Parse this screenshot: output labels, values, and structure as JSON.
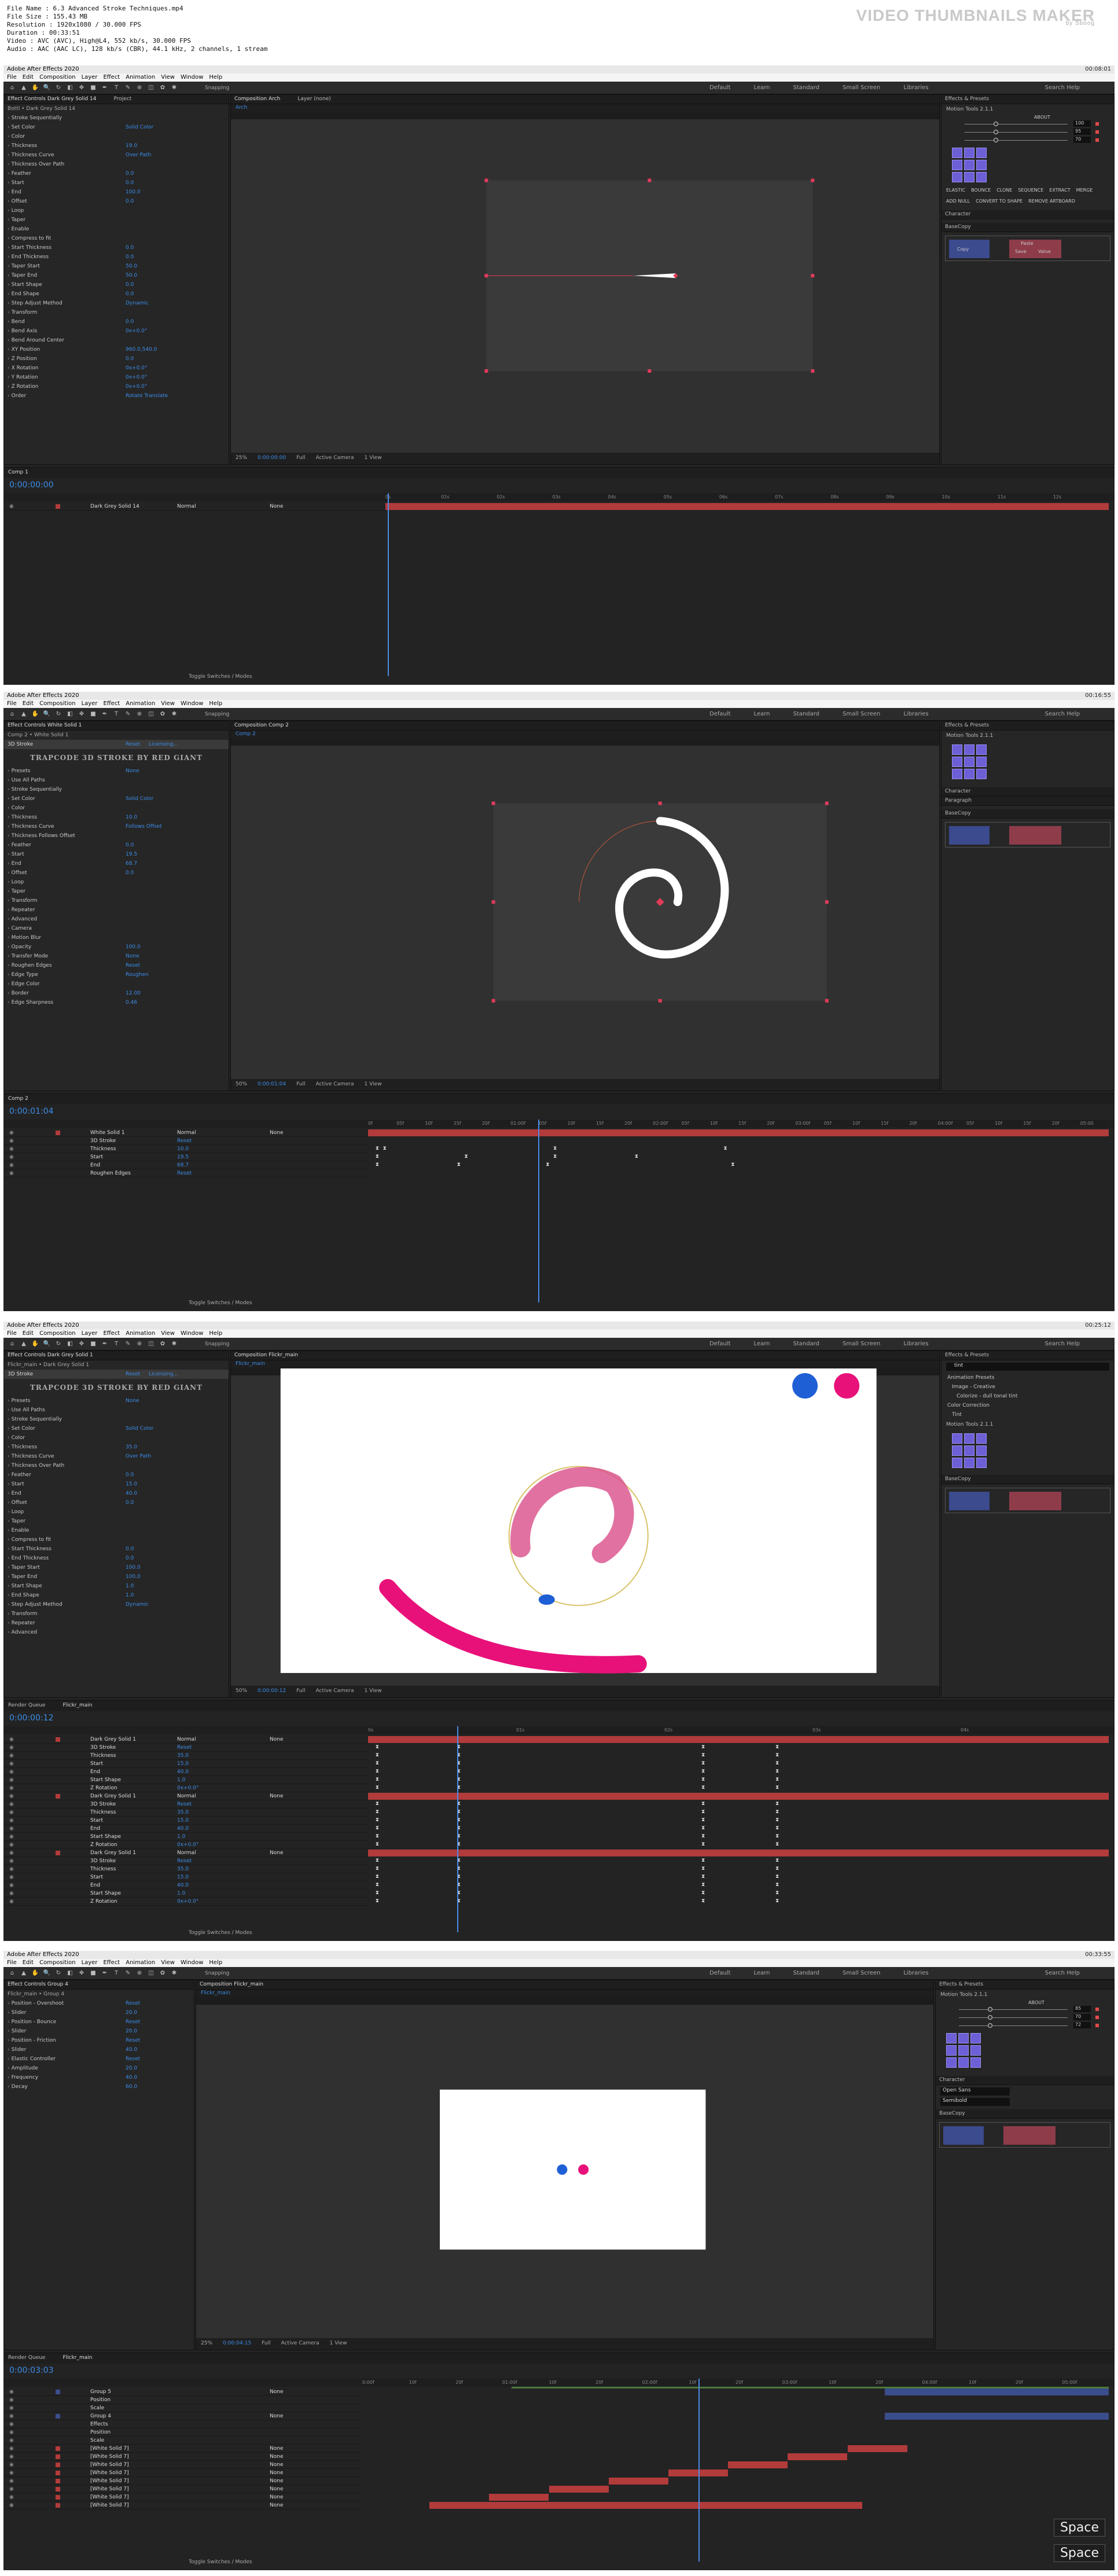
{
  "file_info": {
    "name_label": "File Name",
    "name": "6.3 Advanced Stroke Techniques.mp4",
    "size_label": "File Size",
    "size": "155.43 MB",
    "res_label": "Resolution",
    "resolution": "1920x1080 / 30.000 FPS",
    "dur_label": "Duration",
    "duration": "00:33:51",
    "video_label": "Video",
    "video": "AVC (AVC), High@L4, 552 kb/s, 30.000 FPS",
    "audio_label": "Audio",
    "audio": "AAC (AAC LC), 128 kb/s (CBR), 44.1 kHz, 2 channels, 1 stream",
    "brand": "VIDEO THUMBNAILS MAKER",
    "brand_sub": "by Sboog"
  },
  "app": {
    "title": "Adobe After Effects 2020",
    "menu": [
      "File",
      "Edit",
      "Composition",
      "Layer",
      "Effect",
      "Animation",
      "View",
      "Window",
      "Help"
    ],
    "workspaces": [
      "Default",
      "Learn",
      "Standard",
      "Small Screen",
      "Libraries"
    ],
    "search_help": "Search Help",
    "snapping": "Snapping"
  },
  "frames": [
    {
      "timestamp": "00:08:01",
      "effect_tab": "Effect Controls Dark Grey Solid 14",
      "project_tab": "Project",
      "layer_title": "Bottl • Dark Grey Solid 14",
      "props": [
        {
          "n": "Stroke Sequentially",
          "v": ""
        },
        {
          "n": "Set Color",
          "v": "Solid Color"
        },
        {
          "n": "Color",
          "v": ""
        },
        {
          "n": "Thickness",
          "v": "19.0"
        },
        {
          "n": "Thickness Curve",
          "v": "Over Path"
        },
        {
          "n": "Thickness Over Path",
          "v": ""
        },
        {
          "n": "Feather",
          "v": "0.0"
        },
        {
          "n": "Start",
          "v": "0.0"
        },
        {
          "n": "End",
          "v": "100.0"
        },
        {
          "n": "Offset",
          "v": "0.0"
        },
        {
          "n": "Loop",
          "v": ""
        },
        {
          "n": "Taper",
          "v": ""
        },
        {
          "n": "Enable",
          "v": ""
        },
        {
          "n": "Compress to fit",
          "v": ""
        },
        {
          "n": "Start Thickness",
          "v": "0.0"
        },
        {
          "n": "End Thickness",
          "v": "0.0"
        },
        {
          "n": "Taper Start",
          "v": "50.0"
        },
        {
          "n": "Taper End",
          "v": "50.0"
        },
        {
          "n": "Start Shape",
          "v": "0.0"
        },
        {
          "n": "End Shape",
          "v": "0.0"
        },
        {
          "n": "Step Adjust Method",
          "v": "Dynamic"
        },
        {
          "n": "Transform",
          "v": ""
        },
        {
          "n": "Bend",
          "v": "0.0"
        },
        {
          "n": "Bend Axis",
          "v": "0x+0.0°"
        },
        {
          "n": "Bend Around Center",
          "v": ""
        },
        {
          "n": "XY Position",
          "v": "960.0,540.0"
        },
        {
          "n": "Z Position",
          "v": "0.0"
        },
        {
          "n": "X Rotation",
          "v": "0x+0.0°"
        },
        {
          "n": "Y Rotation",
          "v": "0x+0.0°"
        },
        {
          "n": "Z Rotation",
          "v": "0x+0.0°"
        },
        {
          "n": "Order",
          "v": "Rotate Translate"
        }
      ],
      "comp_tab": "Composition Arch",
      "layer_tab": "Layer (none)",
      "comp_name": "Arch",
      "zoom": "25%",
      "timecode": "0:00:00:00",
      "quality": "Full",
      "camera": "Active Camera",
      "view": "1 View",
      "right_title": "Effects & Presets",
      "plugin": "Motion Tools 2.1.1",
      "plugin_about": "ABOUT",
      "sliders": [
        "100",
        "95",
        "70"
      ],
      "btn_labels": [
        "ELASTIC",
        "BOUNCE",
        "CLONE",
        "SEQUENCE",
        "EXTRACT",
        "MERGE",
        "ADD NULL",
        "CONVERT TO SHAPE",
        "REMOVE ARTBOARD"
      ],
      "character": "Character",
      "basecopy": "BaseCopy",
      "bc_copy": "Copy",
      "bc_paste": "Paste",
      "bc_save": "Save",
      "bc_value": "Value",
      "tl_tab": "Comp 1",
      "tl_timecode": "0:00:00:00",
      "layer_name": "Dark Grey Solid 14",
      "layer_mode": "Normal",
      "layer_parent": "None",
      "toggle": "Toggle Switches / Modes",
      "ruler": [
        "0s",
        "01s",
        "02s",
        "03s",
        "04s",
        "05s",
        "06s",
        "07s",
        "08s",
        "09s",
        "10s",
        "11s",
        "12s"
      ]
    },
    {
      "timestamp": "00:16:55",
      "effect_tab": "Effect Controls White Solid 1",
      "layer_title": "Comp 2 • White Solid 1",
      "fx_name": "3D Stroke",
      "fx_reset": "Reset",
      "fx_licensing": "Licensing...",
      "fx_logo": "TRAPCODE 3D STROKE BY RED GIANT",
      "props": [
        {
          "n": "Presets",
          "v": "None"
        },
        {
          "n": "Use All Paths",
          "v": ""
        },
        {
          "n": "Stroke Sequentially",
          "v": ""
        },
        {
          "n": "Set Color",
          "v": "Solid Color"
        },
        {
          "n": "Color",
          "v": ""
        },
        {
          "n": "Thickness",
          "v": "10.0"
        },
        {
          "n": "Thickness Curve",
          "v": "Follows Offset"
        },
        {
          "n": "Thickness Follows Offset",
          "v": ""
        },
        {
          "n": "Feather",
          "v": "0.0"
        },
        {
          "n": "Start",
          "v": "19.5"
        },
        {
          "n": "End",
          "v": "68.7"
        },
        {
          "n": "Offset",
          "v": "0.0"
        },
        {
          "n": "Loop",
          "v": ""
        },
        {
          "n": "Taper",
          "v": ""
        },
        {
          "n": "Transform",
          "v": ""
        },
        {
          "n": "Repeater",
          "v": ""
        },
        {
          "n": "Advanced",
          "v": ""
        },
        {
          "n": "Camera",
          "v": ""
        },
        {
          "n": "Motion Blur",
          "v": ""
        },
        {
          "n": "Opacity",
          "v": "100.0"
        },
        {
          "n": "Transfer Mode",
          "v": "None"
        },
        {
          "n": "Roughen Edges",
          "v": "Reset"
        },
        {
          "n": "Edge Type",
          "v": "Roughen"
        },
        {
          "n": "Edge Color",
          "v": ""
        },
        {
          "n": "Border",
          "v": "12.00"
        },
        {
          "n": "Edge Sharpness",
          "v": "0.46"
        }
      ],
      "comp_tab": "Composition Comp 2",
      "comp_name": "Comp 2",
      "zoom": "50%",
      "timecode": "0:00:01:04",
      "quality": "Full",
      "camera": "Active Camera",
      "view": "1 View",
      "right_title": "Effects & Presets",
      "plugin": "Motion Tools 2.1.1",
      "character": "Character",
      "paragraph": "Paragraph",
      "basecopy": "BaseCopy",
      "tl_tab": "Comp 2",
      "tl_timecode": "0:00:01:04",
      "layer_name": "White Solid 1",
      "layer_mode": "Normal",
      "layer_parent": "None",
      "sub_rows": [
        {
          "n": "3D Stroke",
          "v": "Reset"
        },
        {
          "n": "Thickness",
          "v": "10.0"
        },
        {
          "n": "Start",
          "v": "19.5"
        },
        {
          "n": "End",
          "v": "68.7"
        },
        {
          "n": "Roughen Edges",
          "v": "Reset"
        }
      ],
      "toggle": "Toggle Switches / Modes",
      "ruler": [
        "0f",
        "05f",
        "10f",
        "15f",
        "20f",
        "01:00f",
        "05f",
        "10f",
        "15f",
        "20f",
        "02:00f",
        "05f",
        "10f",
        "15f",
        "20f",
        "03:00f",
        "05f",
        "10f",
        "15f",
        "20f",
        "04:00f",
        "05f",
        "10f",
        "15f",
        "20f",
        "05:00"
      ]
    },
    {
      "timestamp": "00:25:12",
      "effect_tab": "Effect Controls Dark Grey Solid 1",
      "layer_title": "Flickr_main • Dark Grey Solid 1",
      "fx_name": "3D Stroke",
      "fx_reset": "Reset",
      "fx_licensing": "Licensing...",
      "fx_logo": "TRAPCODE 3D STROKE BY RED GIANT",
      "props": [
        {
          "n": "Presets",
          "v": "None"
        },
        {
          "n": "Use All Paths",
          "v": ""
        },
        {
          "n": "Stroke Sequentially",
          "v": ""
        },
        {
          "n": "Set Color",
          "v": "Solid Color"
        },
        {
          "n": "Color",
          "v": ""
        },
        {
          "n": "Thickness",
          "v": "35.0"
        },
        {
          "n": "Thickness Curve",
          "v": "Over Path"
        },
        {
          "n": "Thickness Over Path",
          "v": ""
        },
        {
          "n": "Feather",
          "v": "0.0"
        },
        {
          "n": "Start",
          "v": "15.0"
        },
        {
          "n": "End",
          "v": "40.0"
        },
        {
          "n": "Offset",
          "v": "0.0"
        },
        {
          "n": "Loop",
          "v": ""
        },
        {
          "n": "Taper",
          "v": ""
        },
        {
          "n": "Enable",
          "v": ""
        },
        {
          "n": "Compress to fit",
          "v": ""
        },
        {
          "n": "Start Thickness",
          "v": "0.0"
        },
        {
          "n": "End Thickness",
          "v": "0.0"
        },
        {
          "n": "Taper Start",
          "v": "100.0"
        },
        {
          "n": "Taper End",
          "v": "100.0"
        },
        {
          "n": "Start Shape",
          "v": "1.0"
        },
        {
          "n": "End Shape",
          "v": "1.0"
        },
        {
          "n": "Step Adjust Method",
          "v": "Dynamic"
        },
        {
          "n": "Transform",
          "v": ""
        },
        {
          "n": "Repeater",
          "v": ""
        },
        {
          "n": "Advanced",
          "v": ""
        }
      ],
      "comp_tab": "Composition Flickr_main",
      "comp_name": "Flickr_main",
      "zoom": "50%",
      "timecode": "0:00:00:12",
      "quality": "Full",
      "camera": "Active Camera",
      "view": "1 View",
      "right_title": "Effects & Presets",
      "fx_search": "tint",
      "fx_tree": [
        "Animation Presets",
        "Image - Creative",
        "Colorize - dull tonal tint",
        "Color Correction",
        "Tint"
      ],
      "plugin": "Motion Tools 2.1.1",
      "basecopy": "BaseCopy",
      "tl_tab": "Flickr_main",
      "render_tab": "Render Queue",
      "tl_timecode": "0:00:00:12",
      "layers": [
        {
          "n": "Dark Grey Solid 1",
          "mode": "Normal",
          "parent": "None"
        },
        {
          "n": "Dark Grey Solid 1",
          "mode": "Normal",
          "parent": "None"
        },
        {
          "n": "Dark Grey Solid 1",
          "mode": "Normal",
          "parent": "None"
        }
      ],
      "sub_rows": [
        {
          "n": "3D Stroke",
          "v": "Reset"
        },
        {
          "n": "Thickness",
          "v": "35.0"
        },
        {
          "n": "Start",
          "v": "15.0"
        },
        {
          "n": "End",
          "v": "40.0"
        },
        {
          "n": "Start Shape",
          "v": "1.0"
        },
        {
          "n": "Z Rotation",
          "v": "0x+0.0°"
        }
      ],
      "toggle": "Toggle Switches / Modes",
      "ruler": [
        "0s",
        "01s",
        "02s",
        "03s",
        "04s"
      ]
    },
    {
      "timestamp": "00:33:55",
      "effect_tab": "Effect Controls Group 4",
      "layer_title": "Flickr_main • Group 4",
      "props": [
        {
          "n": "Position - Overshoot",
          "v": "Reset"
        },
        {
          "n": "Slider",
          "v": "20.0"
        },
        {
          "n": "Position - Bounce",
          "v": "Reset"
        },
        {
          "n": "Slider",
          "v": "20.0"
        },
        {
          "n": "Position - Friction",
          "v": "Reset"
        },
        {
          "n": "Slider",
          "v": "40.0"
        },
        {
          "n": "Elastic Controller",
          "v": "Reset"
        },
        {
          "n": "Amplitude",
          "v": "20.0"
        },
        {
          "n": "Frequency",
          "v": "40.0"
        },
        {
          "n": "Decay",
          "v": "60.0"
        }
      ],
      "comp_tab": "Composition Flickr_main",
      "comp_name": "Flickr_main",
      "zoom": "25%",
      "timecode": "0:00:04:15",
      "quality": "Full",
      "camera": "Active Camera",
      "view": "1 View",
      "right_title": "Effects & Presets",
      "plugin": "Motion Tools 2.1.1",
      "plugin_about": "ABOUT",
      "sliders": [
        "85",
        "70",
        "72"
      ],
      "character": "Character",
      "char_font": "Open Sans",
      "char_style": "Semibold",
      "basecopy": "BaseCopy",
      "render_tab": "Render Queue",
      "tl_tab": "Flickr_main",
      "tl_timecode": "0:00:03:03",
      "layers": [
        {
          "n": "Group 5",
          "mode": "",
          "parent": "None"
        },
        {
          "n": "Position",
          "mode": "",
          "parent": ""
        },
        {
          "n": "Scale",
          "mode": "",
          "parent": ""
        },
        {
          "n": "Group 4",
          "mode": "",
          "parent": "None"
        },
        {
          "n": "Effects",
          "mode": "",
          "parent": ""
        },
        {
          "n": "Position",
          "mode": "",
          "parent": ""
        },
        {
          "n": "Scale",
          "mode": "",
          "parent": ""
        },
        {
          "n": "[White Solid 7]",
          "mode": "",
          "parent": "None"
        },
        {
          "n": "[White Solid 7]",
          "mode": "",
          "parent": "None"
        },
        {
          "n": "[White Solid 7]",
          "mode": "",
          "parent": "None"
        },
        {
          "n": "[White Solid 7]",
          "mode": "",
          "parent": "None"
        },
        {
          "n": "[White Solid 7]",
          "mode": "",
          "parent": "None"
        },
        {
          "n": "[White Solid 7]",
          "mode": "",
          "parent": "None"
        },
        {
          "n": "[White Solid 7]",
          "mode": "",
          "parent": "None"
        },
        {
          "n": "[White Solid 7]",
          "mode": "",
          "parent": "None"
        }
      ],
      "toggle": "Toggle Switches / Modes",
      "space_badge": "Space",
      "ruler": [
        "0:00f",
        "10f",
        "20f",
        "01:00f",
        "10f",
        "20f",
        "02:00f",
        "10f",
        "20f",
        "03:00f",
        "10f",
        "20f",
        "04:00f",
        "10f",
        "20f",
        "05:00f"
      ]
    }
  ]
}
